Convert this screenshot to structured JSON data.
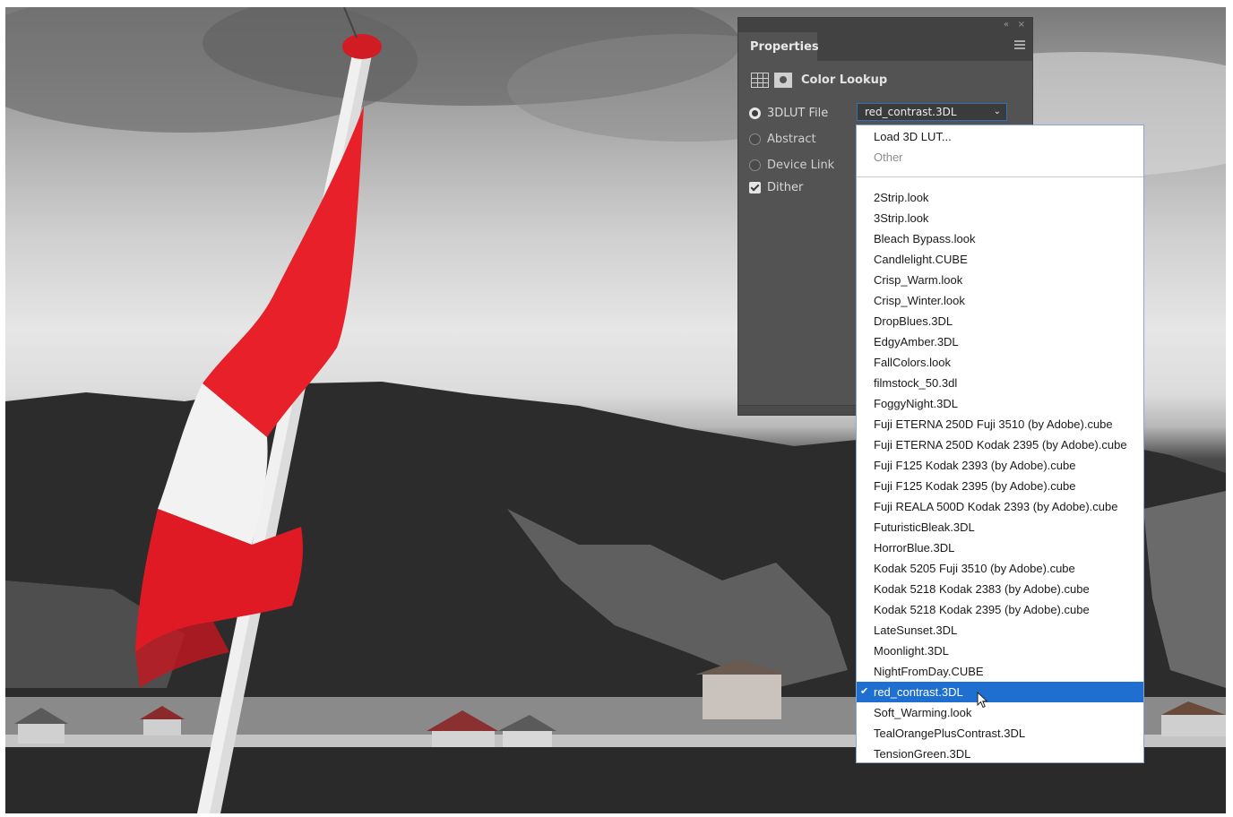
{
  "panel": {
    "tab_label": "Properties",
    "adjustment_title": "Color Lookup",
    "options": {
      "lut_file_label": "3DLUT File",
      "abstract_label": "Abstract",
      "device_link_label": "Device Link",
      "dither_label": "Dither"
    },
    "lut_select_value": "red_contrast.3DL",
    "window_controls": {
      "collapse": "«",
      "close": "×"
    }
  },
  "dropdown": {
    "header_items": [
      {
        "label": "Load 3D LUT...",
        "enabled": true
      },
      {
        "label": "Other",
        "enabled": false
      }
    ],
    "items": [
      "2Strip.look",
      "3Strip.look",
      "Bleach Bypass.look",
      "Candlelight.CUBE",
      "Crisp_Warm.look",
      "Crisp_Winter.look",
      "DropBlues.3DL",
      "EdgyAmber.3DL",
      "FallColors.look",
      "filmstock_50.3dl",
      "FoggyNight.3DL",
      "Fuji ETERNA 250D Fuji 3510 (by Adobe).cube",
      "Fuji ETERNA 250D Kodak 2395 (by Adobe).cube",
      "Fuji F125 Kodak 2393 (by Adobe).cube",
      "Fuji F125 Kodak 2395 (by Adobe).cube",
      "Fuji REALA 500D Kodak 2393 (by Adobe).cube",
      "FuturisticBleak.3DL",
      "HorrorBlue.3DL",
      "Kodak 5205 Fuji 3510 (by Adobe).cube",
      "Kodak 5218 Kodak 2383 (by Adobe).cube",
      "Kodak 5218 Kodak 2395 (by Adobe).cube",
      "LateSunset.3DL",
      "Moonlight.3DL",
      "NightFromDay.CUBE",
      "red_contrast.3DL",
      "Soft_Warming.look",
      "TealOrangePlusContrast.3DL",
      "TensionGreen.3DL"
    ],
    "selected": "red_contrast.3DL",
    "check_glyph": "✔"
  },
  "colors": {
    "panel_bg": "#535353",
    "selection_blue": "#1e6fd0",
    "flag_red": "#e8202a"
  }
}
